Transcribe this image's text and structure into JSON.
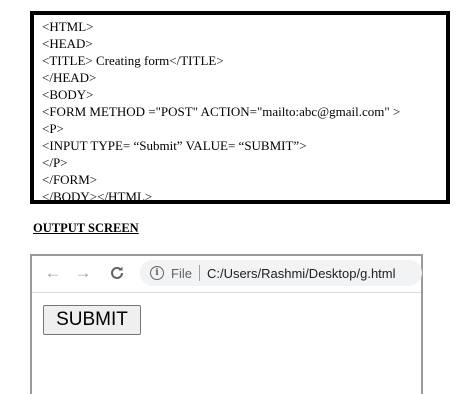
{
  "code_lines": [
    "<HTML>",
    "<HEAD>",
    "<TITLE> Creating form</TITLE>",
    "</HEAD>",
    "<BODY>",
    "<FORM METHOD =\"POST\" ACTION=\"mailto:abc@gmail.com\" >",
    "<P>",
    "<INPUT TYPE= “Submit” VALUE= “SUBMIT”>",
    "</P>",
    "</FORM>",
    "</BODY></HTML>"
  ],
  "output_heading": "OUTPUT SCREEN",
  "browser": {
    "back_icon": "←",
    "forward_icon": "→",
    "reload_icon": "C",
    "info_icon": "i",
    "file_label": "File",
    "url": "C:/Users/Rashmi/Desktop/g.html"
  },
  "form": {
    "submit_label": "SUBMIT"
  }
}
